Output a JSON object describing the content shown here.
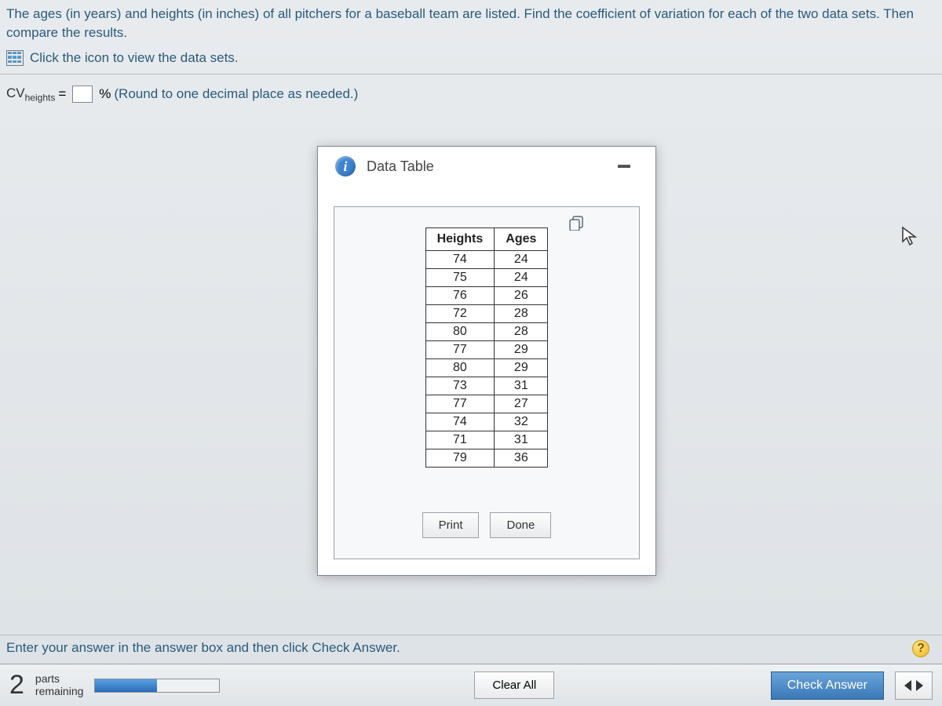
{
  "question": {
    "text": "The ages (in years) and heights (in inches) of all pitchers for a baseball team are listed. Find the coefficient of variation for each of the two data sets. Then compare the results.",
    "data_link_text": "Click the icon to view the data sets."
  },
  "formula": {
    "variable": "CV",
    "subscript": "heights",
    "equals": "=",
    "unit": "%",
    "hint": "(Round to one decimal place as needed.)"
  },
  "dialog": {
    "title": "Data Table",
    "info_glyph": "i",
    "columns": [
      "Heights",
      "Ages"
    ],
    "rows": [
      {
        "h": "74",
        "a": "24"
      },
      {
        "h": "75",
        "a": "24"
      },
      {
        "h": "76",
        "a": "26"
      },
      {
        "h": "72",
        "a": "28"
      },
      {
        "h": "80",
        "a": "28"
      },
      {
        "h": "77",
        "a": "29"
      },
      {
        "h": "80",
        "a": "29"
      },
      {
        "h": "73",
        "a": "31"
      },
      {
        "h": "77",
        "a": "27"
      },
      {
        "h": "74",
        "a": "32"
      },
      {
        "h": "71",
        "a": "31"
      },
      {
        "h": "79",
        "a": "36"
      }
    ],
    "print_label": "Print",
    "done_label": "Done"
  },
  "bottom_hint": "Enter your answer in the answer box and then click Check Answer.",
  "help_glyph": "?",
  "footer": {
    "parts_count": "2",
    "parts_line1": "parts",
    "parts_line2": "remaining",
    "progress_pct": 50,
    "clear_all": "Clear All",
    "check_answer": "Check Answer"
  },
  "chart_data": {
    "type": "table",
    "title": "Data Table",
    "columns": [
      "Heights",
      "Ages"
    ],
    "rows": [
      [
        74,
        24
      ],
      [
        75,
        24
      ],
      [
        76,
        26
      ],
      [
        72,
        28
      ],
      [
        80,
        28
      ],
      [
        77,
        29
      ],
      [
        80,
        29
      ],
      [
        73,
        31
      ],
      [
        77,
        27
      ],
      [
        74,
        32
      ],
      [
        71,
        31
      ],
      [
        79,
        36
      ]
    ]
  }
}
